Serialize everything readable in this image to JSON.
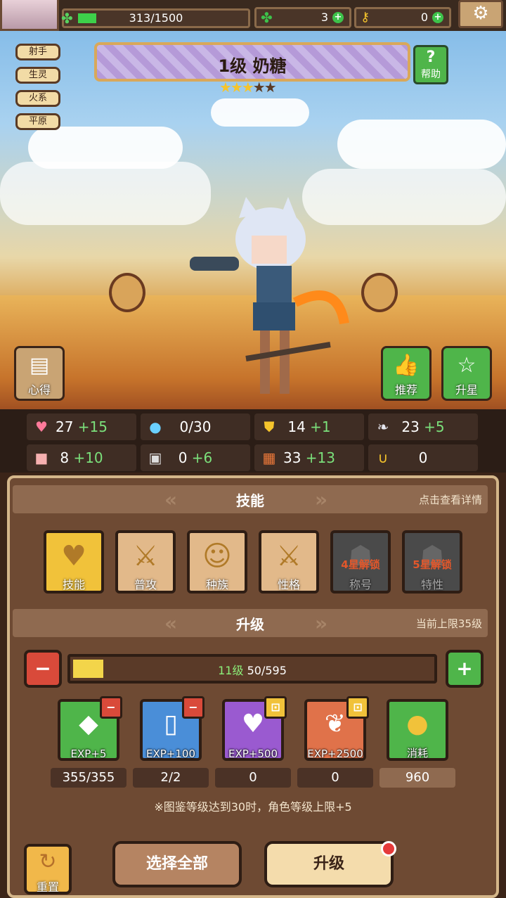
{
  "topbar": {
    "exp_text": "313/1500",
    "res1_value": "3",
    "res2_value": "0"
  },
  "tags": [
    "射手",
    "生灵",
    "火系",
    "平原"
  ],
  "hero": {
    "name": "1级 奶糖",
    "stars_on": "★★★",
    "stars_off": "★★"
  },
  "help": {
    "label": "帮助"
  },
  "side": {
    "notes": "心得",
    "recommend": "推荐",
    "starup": "升星"
  },
  "stats": [
    {
      "icon": "heart-icon",
      "value": "27",
      "bonus": "+15",
      "color": "#ff7a9a"
    },
    {
      "icon": "water-drop-icon",
      "value": "0/30",
      "bonus": "",
      "color": "#6ad0ff"
    },
    {
      "icon": "shield-icon",
      "value": "14",
      "bonus": "+1",
      "color": "#f5c42c"
    },
    {
      "icon": "wing-icon",
      "value": "23",
      "bonus": "+5",
      "color": "#e6e6ee"
    },
    {
      "icon": "fist-icon",
      "value": "8",
      "bonus": "+10",
      "color": "#f6b0b0"
    },
    {
      "icon": "book-icon",
      "value": "0",
      "bonus": "+6",
      "color": "#dddddd"
    },
    {
      "icon": "scroll-icon",
      "value": "33",
      "bonus": "+13",
      "color": "#f07a3a"
    },
    {
      "icon": "horseshoe-icon",
      "value": "0",
      "bonus": "",
      "color": "#f5c42c"
    }
  ],
  "skills_section": {
    "title": "技能",
    "hint": "点击查看详情"
  },
  "skills": [
    {
      "label": "技能",
      "lock": ""
    },
    {
      "label": "普攻",
      "lock": ""
    },
    {
      "label": "种族",
      "lock": ""
    },
    {
      "label": "性格",
      "lock": ""
    },
    {
      "label": "称号",
      "lock": "4星解锁"
    },
    {
      "label": "特性",
      "lock": "5星解锁"
    }
  ],
  "upgrade_section": {
    "title": "升级",
    "hint": "当前上限35级"
  },
  "level": {
    "level_label": "11级",
    "exp": "50/595",
    "progress": 0.084
  },
  "items": [
    {
      "label": "EXP+5",
      "count": "355/355",
      "color": "#4fb54a"
    },
    {
      "label": "EXP+100",
      "count": "2/2",
      "color": "#4a8ed8"
    },
    {
      "label": "EXP+500",
      "count": "0",
      "color": "#9a5ad0"
    },
    {
      "label": "EXP+2500",
      "count": "0",
      "color": "#e0724a"
    },
    {
      "label": "消耗",
      "count": "960",
      "color": "#4fb54a"
    }
  ],
  "note": "※图鉴等级达到30时，角色等级上限+5",
  "buttons": {
    "reset": "重置",
    "select_all": "选择全部",
    "upgrade": "升级"
  }
}
